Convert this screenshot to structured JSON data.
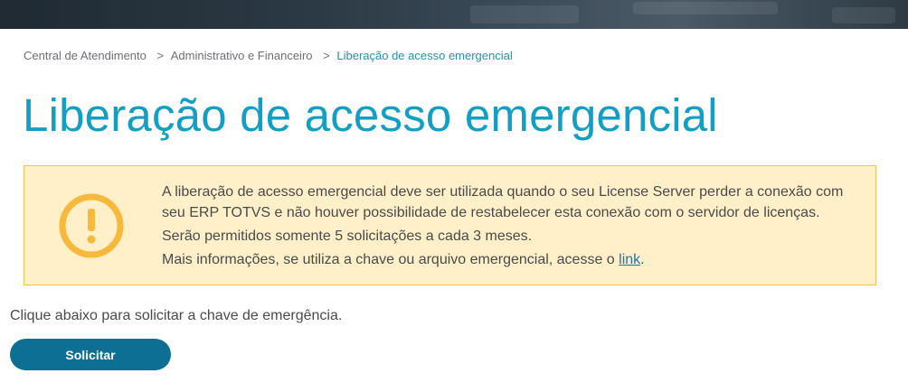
{
  "breadcrumb": {
    "items": [
      {
        "label": "Central de Atendimento"
      },
      {
        "label": "Administrativo e Financeiro"
      },
      {
        "label": "Liberação de acesso emergencial"
      }
    ],
    "separator": ">"
  },
  "page": {
    "title": "Liberação de acesso emergencial"
  },
  "alert": {
    "icon": "exclamation-circle-icon",
    "line1": "A liberação de acesso emergencial deve ser utilizada quando o seu License Server perder a conexão com seu ERP TOTVS e não houver possibilidade de restabelecer esta conexão com o servidor de licenças.",
    "line2": "Serão permitidos somente 5 solicitações a cada 3 meses.",
    "line3_prefix": "Mais informações, se utiliza a chave ou arquivo emergencial, acesse o ",
    "line3_link": "link",
    "line3_suffix": "."
  },
  "intro": "Clique abaixo para solicitar a chave de emergência.",
  "actions": {
    "request_label": "Solicitar"
  },
  "colors": {
    "title": "#139fc3",
    "alert_bg": "#fff0c9",
    "alert_border": "#f1c25a",
    "icon": "#f6b93b",
    "button": "#0e6f95"
  }
}
